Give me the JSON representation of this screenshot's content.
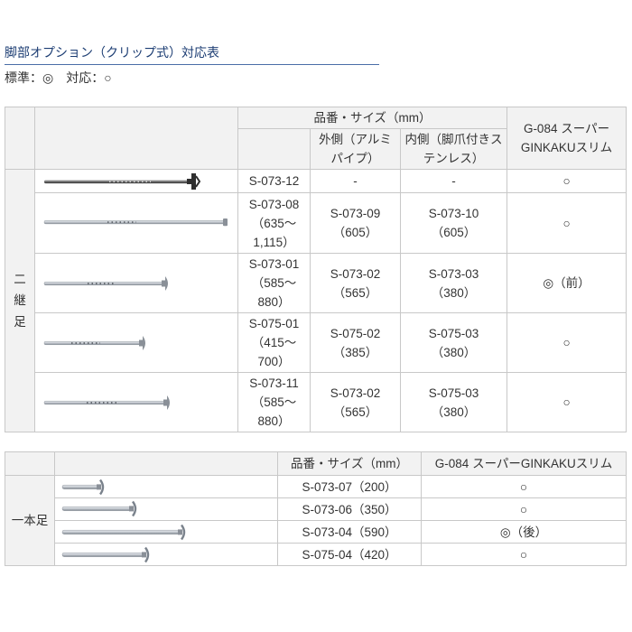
{
  "title": "脚部オプション（クリップ式）対応表",
  "legend": "標準：◎　対応：○",
  "colors": {
    "title": "#1c3d73",
    "title_rule": "#4a6da7",
    "header_bg": "#f2f2f2",
    "border": "#c8c8c8",
    "text": "#333333"
  },
  "two_section": {
    "label": "二継足",
    "header": {
      "part_size": "品番・サイズ（mm）",
      "outer": "外側（アルミパイプ）",
      "inner": "内側（脚爪付きステンレス）",
      "model": "G-084 スーパーGINKAKUスリム"
    },
    "rows": [
      {
        "part": "S-073-12",
        "outer": "-",
        "inner": "-",
        "compat": "○"
      },
      {
        "part": "S-073-08",
        "part_size": "（635～1,115）",
        "outer": "S-073-09",
        "outer_size": "（605）",
        "inner": "S-073-10",
        "inner_size": "（605）",
        "compat": "○"
      },
      {
        "part": "S-073-01",
        "part_size": "（585～880）",
        "outer": "S-073-02",
        "outer_size": "（565）",
        "inner": "S-073-03",
        "inner_size": "（380）",
        "compat": "◎（前）"
      },
      {
        "part": "S-075-01",
        "part_size": "（415～700）",
        "outer": "S-075-02",
        "outer_size": "（385）",
        "inner": "S-075-03",
        "inner_size": "（380）",
        "compat": "○"
      },
      {
        "part": "S-073-11",
        "part_size": "（585～880）",
        "outer": "S-073-02",
        "outer_size": "（565）",
        "inner": "S-075-03",
        "inner_size": "（380）",
        "compat": "○"
      }
    ]
  },
  "single": {
    "label": "一本足",
    "header": {
      "part_size": "品番・サイズ（mm）",
      "model": "G-084 スーパーGINKAKUスリム"
    },
    "rows": [
      {
        "part": "S-073-07",
        "size": "（200）",
        "compat": "○"
      },
      {
        "part": "S-073-06",
        "size": "（350）",
        "compat": "○"
      },
      {
        "part": "S-073-04",
        "size": "（590）",
        "compat": "◎（後）"
      },
      {
        "part": "S-075-04",
        "size": "（420）",
        "compat": "○"
      }
    ]
  }
}
